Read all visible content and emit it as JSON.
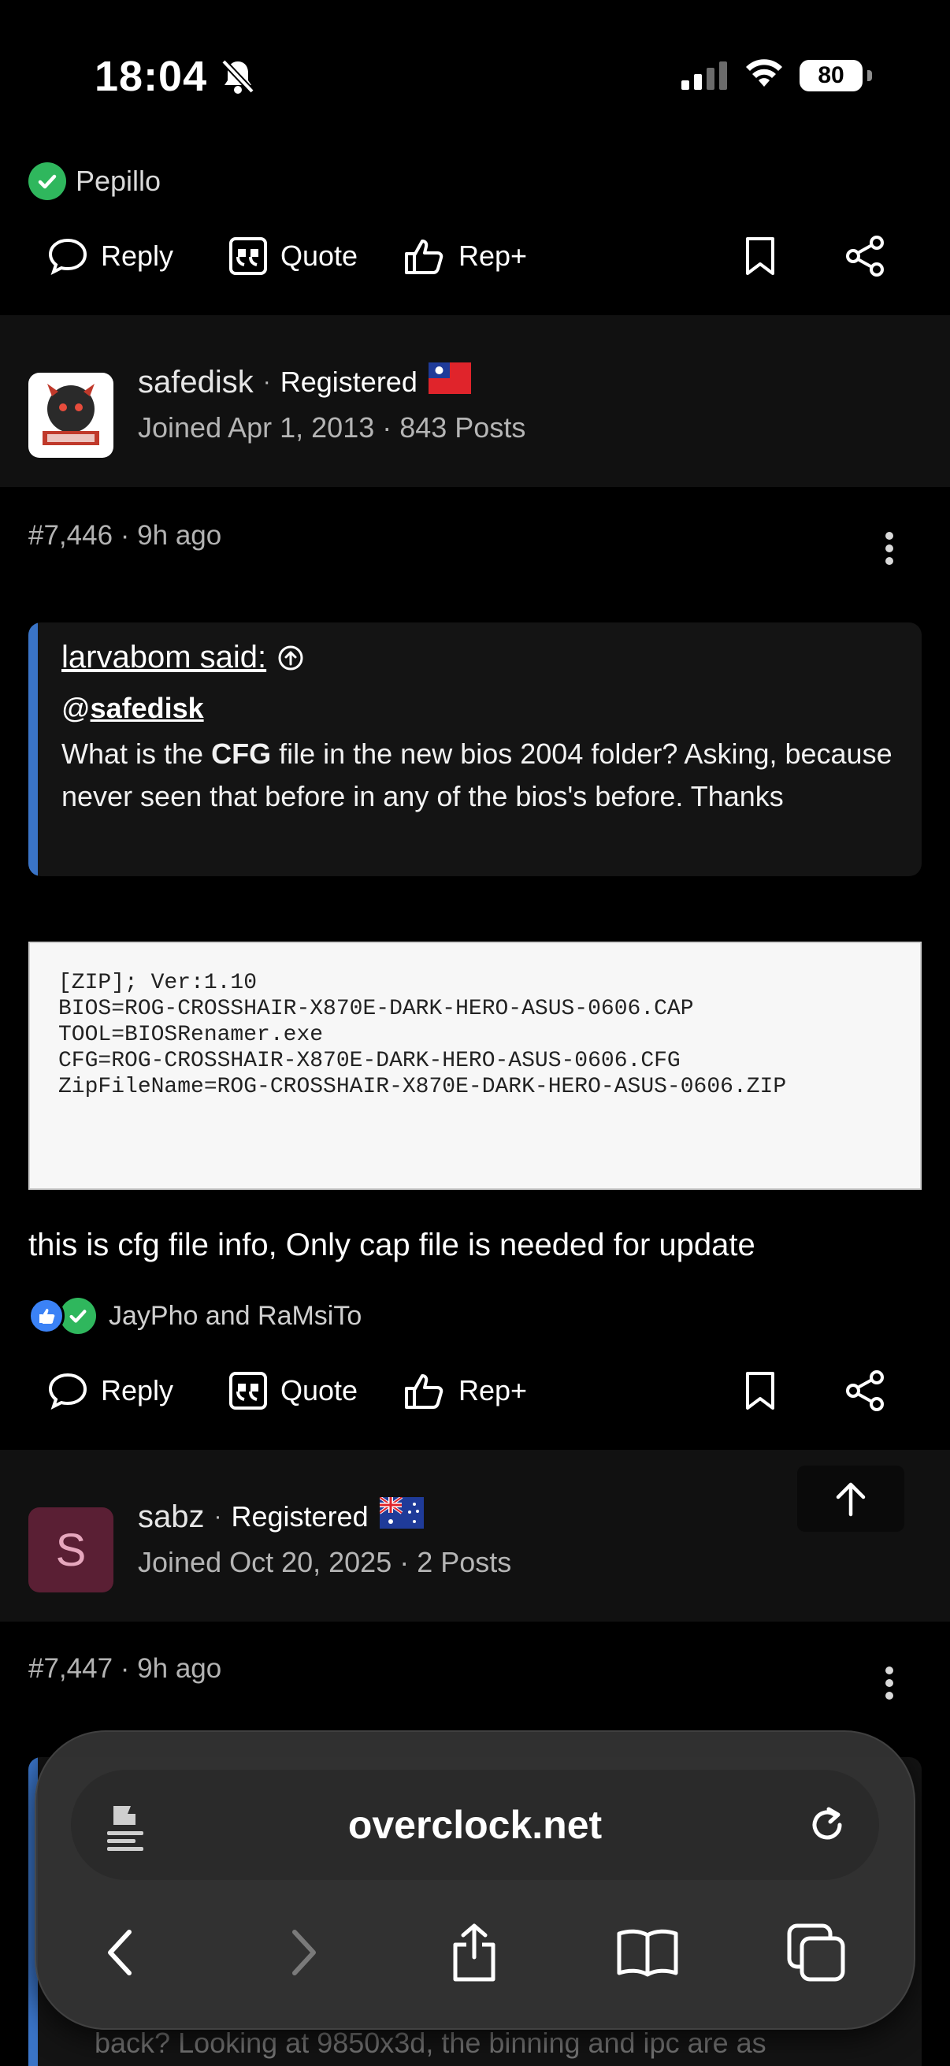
{
  "status_bar": {
    "time": "18:04",
    "battery": "80"
  },
  "prev_post": {
    "reacted_user": "Pepillo"
  },
  "actions": {
    "reply": "Reply",
    "quote": "Quote",
    "rep": "Rep+"
  },
  "post1": {
    "username": "safedisk",
    "role": "Registered",
    "joined": "Joined Apr 1, 2013 · 843 Posts",
    "number": "#7,446",
    "age": "9h ago",
    "quote": {
      "author": "larvabom said:",
      "mention_at": "@",
      "mention": "safedisk",
      "body_before": "What is the ",
      "body_bold": "CFG",
      "body_after": " file in the new bios 2004 folder? Asking, because never seen that before in any of the bios's before. Thanks"
    },
    "attachment_text": "[ZIP]; Ver:1.10\nBIOS=ROG-CROSSHAIR-X870E-DARK-HERO-ASUS-0606.CAP\nTOOL=BIOSRenamer.exe\nCFG=ROG-CROSSHAIR-X870E-DARK-HERO-ASUS-0606.CFG\nZipFileName=ROG-CROSSHAIR-X870E-DARK-HERO-ASUS-0606.ZIP",
    "text": "this is cfg file info, Only cap file is needed for update",
    "reactions": "JayPho and RaMsiTo"
  },
  "post2": {
    "avatar_letter": "S",
    "username": "sabz",
    "role": "Registered",
    "joined": "Joined Oct 20, 2025 · 2 Posts",
    "number": "#7,447",
    "age": "9h ago",
    "quote_preview": "back? Looking at 9850x3d, the binning and ipc are as"
  },
  "browser": {
    "url": "overclock.net"
  },
  "colors": {
    "accent_blue": "#3a74c7",
    "check_green": "#2fb75d",
    "card_bg": "#111111"
  }
}
